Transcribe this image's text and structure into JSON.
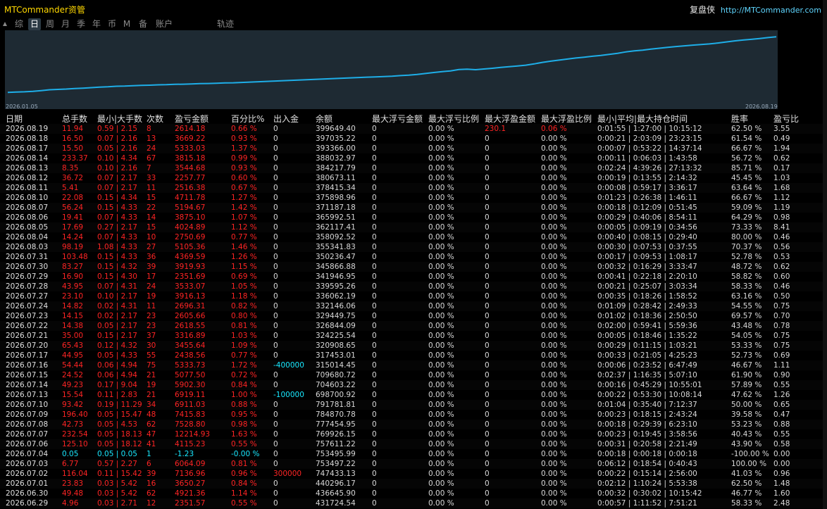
{
  "header": {
    "title": "MTCommander资管",
    "brand_name": "复盘侠",
    "brand_url": "http://MTCommander.com"
  },
  "tabs": [
    {
      "label": "综",
      "active": false
    },
    {
      "label": "日",
      "active": true
    },
    {
      "label": "周",
      "active": false
    },
    {
      "label": "月",
      "active": false
    },
    {
      "label": "季",
      "active": false
    },
    {
      "label": "年",
      "active": false
    },
    {
      "label": "币",
      "active": false
    },
    {
      "label": "M",
      "active": false
    },
    {
      "label": "备",
      "active": false
    },
    {
      "label": "账户",
      "active": false
    },
    {
      "label": "轨迹",
      "active": false
    }
  ],
  "chart_data": {
    "type": "line",
    "x_start_label": "2026.01.05",
    "x_end_label": "2026.08.19",
    "line_color": "#1eaee8",
    "background": "#1e2a33",
    "series": [
      {
        "values": [
          80,
          82,
          83,
          86,
          90,
          95,
          97,
          99,
          102,
          104,
          107,
          110,
          112,
          115,
          116,
          118,
          120,
          121,
          123,
          124,
          126,
          127,
          128,
          130,
          131,
          132,
          134,
          135,
          137,
          139,
          141,
          143,
          145,
          147,
          149,
          151,
          153,
          155,
          157,
          159,
          161,
          163,
          165,
          167,
          169,
          171,
          173,
          176,
          179,
          183,
          188,
          194,
          199,
          203,
          211,
          213,
          210,
          214,
          218,
          223,
          227,
          231,
          236,
          243,
          252,
          259,
          265,
          271,
          277,
          282,
          287,
          292,
          298,
          304,
          312,
          318,
          322,
          328,
          333,
          338,
          343,
          347,
          351,
          354,
          358,
          363,
          369,
          375,
          380,
          384,
          389,
          394,
          399
        ]
      }
    ],
    "ylim": [
      0,
      420
    ]
  },
  "table": {
    "headers": [
      "日期",
      "总手数",
      "最小|大手数",
      "次数",
      "盈亏金额",
      "百分比%",
      "出入金",
      "余额",
      "最大浮亏金额",
      "最大浮亏比例",
      "最大浮盈金额",
      "最大浮盈比例",
      "最小|平均|最大持仓时间",
      "胜率",
      "盈亏比"
    ],
    "rows": [
      [
        "2026.08.19",
        "11.94",
        "0.59 | 2.15",
        "8",
        "2614.18",
        "0.66 %",
        "0",
        "399649.40",
        "0",
        "0.00 %",
        "230.1",
        "0.06 %",
        "0:01:55 | 1:27:00 | 10:15:12",
        "62.50 %",
        "3.55"
      ],
      [
        "2026.08.18",
        "16.50",
        "0.07 | 2.16",
        "13",
        "3669.22",
        "0.93 %",
        "0",
        "397035.22",
        "0",
        "0.00 %",
        "0",
        "0.00 %",
        "0:00:21 | 2:03:09 | 23:23:15",
        "61.54 %",
        "0.49"
      ],
      [
        "2026.08.17",
        "15.50",
        "0.05 | 2.16",
        "24",
        "5333.03",
        "1.37 %",
        "0",
        "393366.00",
        "0",
        "0.00 %",
        "0",
        "0.00 %",
        "0:00:07 | 0:53:22 | 14:37:14",
        "66.67 %",
        "1.94"
      ],
      [
        "2026.08.14",
        "233.37",
        "0.10 | 4.34",
        "67",
        "3815.18",
        "0.99 %",
        "0",
        "388032.97",
        "0",
        "0.00 %",
        "0",
        "0.00 %",
        "0:00:11 | 0:06:03 | 1:43:58",
        "56.72 %",
        "0.62"
      ],
      [
        "2026.08.13",
        "8.35",
        "0.10 | 2.16",
        "7",
        "3544.68",
        "0.93 %",
        "0",
        "384217.79",
        "0",
        "0.00 %",
        "0",
        "0.00 %",
        "0:02:24 | 4:39:26 | 27:13:32",
        "85.71 %",
        "0.17"
      ],
      [
        "2026.08.12",
        "36.72",
        "0.07 | 2.17",
        "33",
        "2257.77",
        "0.60 %",
        "0",
        "380673.11",
        "0",
        "0.00 %",
        "0",
        "0.00 %",
        "0:00:19 | 0:13:55 | 2:14:32",
        "45.45 %",
        "1.03"
      ],
      [
        "2026.08.11",
        "5.41",
        "0.07 | 2.17",
        "11",
        "2516.38",
        "0.67 %",
        "0",
        "378415.34",
        "0",
        "0.00 %",
        "0",
        "0.00 %",
        "0:00:08 | 0:59:17 | 3:36:17",
        "63.64 %",
        "1.68"
      ],
      [
        "2026.08.10",
        "22.08",
        "0.15 | 4.34",
        "15",
        "4711.78",
        "1.27 %",
        "0",
        "375898.96",
        "0",
        "0.00 %",
        "0",
        "0.00 %",
        "0:01:23 | 0:26:38 | 1:46:11",
        "66.67 %",
        "1.12"
      ],
      [
        "2026.08.07",
        "56.24",
        "0.15 | 4.33",
        "22",
        "5194.67",
        "1.42 %",
        "0",
        "371187.18",
        "0",
        "0.00 %",
        "0",
        "0.00 %",
        "0:00:18 | 0:12:09 | 0:51:45",
        "59.09 %",
        "1.19"
      ],
      [
        "2026.08.06",
        "19.41",
        "0.07 | 4.33",
        "14",
        "3875.10",
        "1.07 %",
        "0",
        "365992.51",
        "0",
        "0.00 %",
        "0",
        "0.00 %",
        "0:00:29 | 0:40:06 | 8:54:11",
        "64.29 %",
        "0.98"
      ],
      [
        "2026.08.05",
        "17.69",
        "0.27 | 2.17",
        "15",
        "4024.89",
        "1.12 %",
        "0",
        "362117.41",
        "0",
        "0.00 %",
        "0",
        "0.00 %",
        "0:00:05 | 0:09:19 | 0:34:56",
        "73.33 %",
        "8.41"
      ],
      [
        "2026.08.04",
        "14.24",
        "0.07 | 4.33",
        "10",
        "2750.69",
        "0.77 %",
        "0",
        "358092.52",
        "0",
        "0.00 %",
        "0",
        "0.00 %",
        "0:00:40 | 0:08:15 | 0:29:40",
        "80.00 %",
        "0.46"
      ],
      [
        "2026.08.03",
        "98.19",
        "1.08 | 4.33",
        "27",
        "5105.36",
        "1.46 %",
        "0",
        "355341.83",
        "0",
        "0.00 %",
        "0",
        "0.00 %",
        "0:00:30 | 0:07:53 | 0:37:55",
        "70.37 %",
        "0.56"
      ],
      [
        "2026.07.31",
        "103.48",
        "0.15 | 4.33",
        "36",
        "4369.59",
        "1.26 %",
        "0",
        "350236.47",
        "0",
        "0.00 %",
        "0",
        "0.00 %",
        "0:00:17 | 0:09:53 | 1:08:17",
        "52.78 %",
        "0.53"
      ],
      [
        "2026.07.30",
        "83.27",
        "0.15 | 4.32",
        "39",
        "3919.93",
        "1.15 %",
        "0",
        "345866.88",
        "0",
        "0.00 %",
        "0",
        "0.00 %",
        "0:00:32 | 0:16:29 | 3:33:47",
        "48.72 %",
        "0.62"
      ],
      [
        "2026.07.29",
        "16.90",
        "0.15 | 4.30",
        "17",
        "2351.69",
        "0.69 %",
        "0",
        "341946.95",
        "0",
        "0.00 %",
        "0",
        "0.00 %",
        "0:00:41 | 0:22:18 | 2:20:10",
        "58.82 %",
        "0.60"
      ],
      [
        "2026.07.28",
        "43.95",
        "0.07 | 4.31",
        "24",
        "3533.07",
        "1.05 %",
        "0",
        "339595.26",
        "0",
        "0.00 %",
        "0",
        "0.00 %",
        "0:00:21 | 0:25:07 | 3:03:34",
        "58.33 %",
        "0.46"
      ],
      [
        "2026.07.27",
        "23.10",
        "0.10 | 2.17",
        "19",
        "3916.13",
        "1.18 %",
        "0",
        "336062.19",
        "0",
        "0.00 %",
        "0",
        "0.00 %",
        "0:00:35 | 0:18:26 | 1:58:52",
        "63.16 %",
        "0.50"
      ],
      [
        "2026.07.24",
        "14.82",
        "0.02 | 4.31",
        "11",
        "2696.31",
        "0.82 %",
        "0",
        "332146.06",
        "0",
        "0.00 %",
        "0",
        "0.00 %",
        "0:01:09 | 0:28:42 | 2:49:33",
        "54.55 %",
        "0.75"
      ],
      [
        "2026.07.23",
        "14.15",
        "0.02 | 2.17",
        "23",
        "2605.66",
        "0.80 %",
        "0",
        "329449.75",
        "0",
        "0.00 %",
        "0",
        "0.00 %",
        "0:01:02 | 0:18:36 | 2:50:50",
        "69.57 %",
        "0.70"
      ],
      [
        "2026.07.22",
        "14.38",
        "0.05 | 2.17",
        "23",
        "2618.55",
        "0.81 %",
        "0",
        "326844.09",
        "0",
        "0.00 %",
        "0",
        "0.00 %",
        "0:02:00 | 0:59:41 | 5:59:36",
        "43.48 %",
        "0.78"
      ],
      [
        "2026.07.21",
        "35.00",
        "0.15 | 2.17",
        "37",
        "3316.89",
        "1.03 %",
        "0",
        "324225.54",
        "0",
        "0.00 %",
        "0",
        "0.00 %",
        "0:00:05 | 0:18:46 | 1:35:22",
        "54.05 %",
        "0.75"
      ],
      [
        "2026.07.20",
        "65.43",
        "0.12 | 4.32",
        "30",
        "3455.64",
        "1.09 %",
        "0",
        "320908.65",
        "0",
        "0.00 %",
        "0",
        "0.00 %",
        "0:00:29 | 0:11:15 | 1:03:21",
        "53.33 %",
        "0.75"
      ],
      [
        "2026.07.17",
        "44.95",
        "0.05 | 4.33",
        "55",
        "2438.56",
        "0.77 %",
        "0",
        "317453.01",
        "0",
        "0.00 %",
        "0",
        "0.00 %",
        "0:00:33 | 0:21:05 | 4:25:23",
        "52.73 %",
        "0.69"
      ],
      [
        "2026.07.16",
        "54.44",
        "0.06 | 4.94",
        "75",
        "5333.73",
        "1.72 %",
        "-400000",
        "315014.45",
        "0",
        "0.00 %",
        "0",
        "0.00 %",
        "0:00:06 | 0:23:52 | 6:47:49",
        "46.67 %",
        "1.11"
      ],
      [
        "2026.07.15",
        "24.52",
        "0.06 | 4.94",
        "21",
        "5077.50",
        "0.72 %",
        "0",
        "709680.72",
        "0",
        "0.00 %",
        "0",
        "0.00 %",
        "0:02:37 | 1:16:35 | 5:07:10",
        "61.90 %",
        "0.90"
      ],
      [
        "2026.07.14",
        "49.23",
        "0.17 | 9.04",
        "19",
        "5902.30",
        "0.84 %",
        "0",
        "704603.22",
        "0",
        "0.00 %",
        "0",
        "0.00 %",
        "0:00:16 | 0:45:29 | 10:55:01",
        "57.89 %",
        "0.55"
      ],
      [
        "2026.07.13",
        "15.54",
        "0.11 | 2.83",
        "21",
        "6919.11",
        "1.00 %",
        "-100000",
        "698700.92",
        "0",
        "0.00 %",
        "0",
        "0.00 %",
        "0:00:22 | 0:53:30 | 10:08:14",
        "47.62 %",
        "1.26"
      ],
      [
        "2026.07.10",
        "93.42",
        "0.19 | 11.29",
        "34",
        "6911.03",
        "0.88 %",
        "0",
        "791781.81",
        "0",
        "0.00 %",
        "0",
        "0.00 %",
        "0:01:04 | 0:35:40 | 7:12:37",
        "50.00 %",
        "0.65"
      ],
      [
        "2026.07.09",
        "196.40",
        "0.05 | 15.47",
        "48",
        "7415.83",
        "0.95 %",
        "0",
        "784870.78",
        "0",
        "0.00 %",
        "0",
        "0.00 %",
        "0:00:23 | 0:18:15 | 2:43:24",
        "39.58 %",
        "0.47"
      ],
      [
        "2026.07.08",
        "42.73",
        "0.05 | 4.53",
        "62",
        "7528.80",
        "0.98 %",
        "0",
        "777454.95",
        "0",
        "0.00 %",
        "0",
        "0.00 %",
        "0:00:18 | 0:29:39 | 6:23:10",
        "53.23 %",
        "0.88"
      ],
      [
        "2026.07.07",
        "232.54",
        "0.05 | 18.13",
        "47",
        "12214.93",
        "1.63 %",
        "0",
        "769926.15",
        "0",
        "0.00 %",
        "0",
        "0.00 %",
        "0:00:23 | 0:19:45 | 3:58:56",
        "40.43 %",
        "0.55"
      ],
      [
        "2026.07.06",
        "125.10",
        "0.05 | 18.12",
        "41",
        "4115.23",
        "0.55 %",
        "0",
        "757611.22",
        "0",
        "0.00 %",
        "0",
        "0.00 %",
        "0:00:31 | 0:20:58 | 2:21:49",
        "43.90 %",
        "0.58"
      ],
      [
        "2026.07.04",
        "0.05",
        "0.05 | 0.05",
        "1",
        "-1.23",
        "-0.00 %",
        "0",
        "753495.99",
        "0",
        "0.00 %",
        "0",
        "0.00 %",
        "0:00:18 | 0:00:18 | 0:00:18",
        "-100.00 %",
        "0.00"
      ],
      [
        "2026.07.03",
        "6.77",
        "0.57 | 2.27",
        "6",
        "6064.09",
        "0.81 %",
        "0",
        "753497.22",
        "0",
        "0.00 %",
        "0",
        "0.00 %",
        "0:06:12 | 0:18:54 | 0:40:43",
        "100.00 %",
        "0.00"
      ],
      [
        "2026.07.02",
        "116.04",
        "0.11 | 15.42",
        "39",
        "7136.96",
        "0.96 %",
        "300000",
        "747433.13",
        "0",
        "0.00 %",
        "0",
        "0.00 %",
        "0:00:22 | 0:15:14 | 2:56:00",
        "41.03 %",
        "0.96"
      ],
      [
        "2026.07.01",
        "23.83",
        "0.03 | 5.42",
        "16",
        "3650.27",
        "0.84 %",
        "0",
        "440296.17",
        "0",
        "0.00 %",
        "0",
        "0.00 %",
        "0:02:12 | 1:10:24 | 5:53:38",
        "62.50 %",
        "1.48"
      ],
      [
        "2026.06.30",
        "49.48",
        "0.03 | 5.42",
        "62",
        "4921.36",
        "1.14 %",
        "0",
        "436645.90",
        "0",
        "0.00 %",
        "0",
        "0.00 %",
        "0:00:32 | 0:30:02 | 10:15:42",
        "46.77 %",
        "1.60"
      ],
      [
        "2026.06.29",
        "4.96",
        "0.03 | 2.71",
        "12",
        "2351.57",
        "0.55 %",
        "0",
        "431724.54",
        "0",
        "0.00 %",
        "0",
        "0.00 %",
        "0:00:57 | 1:11:52 | 7:51:21",
        "58.33 %",
        "2.48"
      ]
    ]
  }
}
